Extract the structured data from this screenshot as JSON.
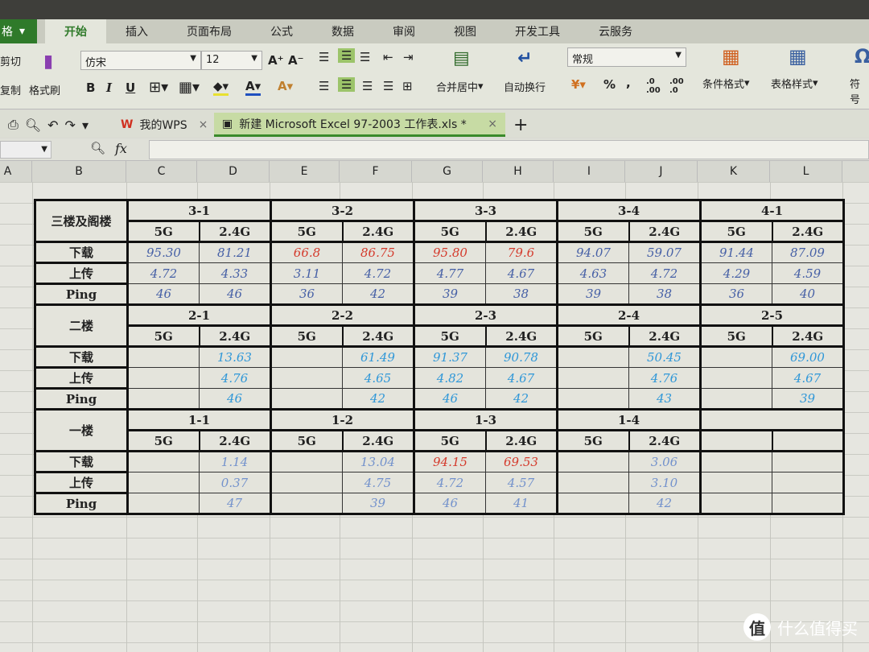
{
  "app": {
    "menu_label": "格"
  },
  "ribbon_tabs": [
    "开始",
    "插入",
    "页面布局",
    "公式",
    "数据",
    "审阅",
    "视图",
    "开发工具",
    "云服务"
  ],
  "active_tab": "开始",
  "ribbon": {
    "cut": "剪切",
    "copy": "复制",
    "format_painter": "格式刷",
    "font_name": "仿宋",
    "font_size": "12",
    "merge_center": "合并居中",
    "wrap_text": "自动换行",
    "number_format": "常规",
    "percent": "%",
    "comma": ",",
    "conditional_format": "条件格式",
    "table_style": "表格样式",
    "symbol": "符号",
    "bold": "B",
    "italic": "I",
    "underline": "U"
  },
  "doc_tabs": [
    {
      "label": "我的WPS",
      "active": false
    },
    {
      "label": "新建 Microsoft Excel 97-2003 工作表.xls *",
      "active": true
    }
  ],
  "formula_bar": {
    "fx": "fx",
    "value": ""
  },
  "columns": [
    "A",
    "B",
    "C",
    "D",
    "E",
    "F",
    "G",
    "H",
    "I",
    "J",
    "K",
    "L"
  ],
  "row_labels": {
    "down": "下载",
    "up": "上传",
    "ping": "Ping"
  },
  "colors": {
    "red": "#d43a2c",
    "navy": "#4660a6",
    "sky": "#2f97d8",
    "steel": "#7392cc"
  },
  "floors": [
    {
      "label": "三楼及阁楼",
      "units": [
        {
          "name": "3-1",
          "cols": [
            {
              "band": "5G",
              "down": "95.30",
              "up": "4.72",
              "ping": "46",
              "c": "navy"
            },
            {
              "band": "2.4G",
              "down": "81.21",
              "up": "4.33",
              "ping": "46",
              "c": "navy"
            }
          ]
        },
        {
          "name": "3-2",
          "cols": [
            {
              "band": "5G",
              "down": "66.8",
              "up": "3.11",
              "ping": "36",
              "c": "navy",
              "dc": "red"
            },
            {
              "band": "2.4G",
              "down": "86.75",
              "up": "4.72",
              "ping": "42",
              "c": "navy",
              "dc": "red"
            }
          ]
        },
        {
          "name": "3-3",
          "cols": [
            {
              "band": "5G",
              "down": "95.80",
              "up": "4.77",
              "ping": "39",
              "c": "navy",
              "dc": "red"
            },
            {
              "band": "2.4G",
              "down": "79.6",
              "up": "4.67",
              "ping": "38",
              "c": "navy",
              "dc": "red"
            }
          ]
        },
        {
          "name": "3-4",
          "cols": [
            {
              "band": "5G",
              "down": "94.07",
              "up": "4.63",
              "ping": "39",
              "c": "navy"
            },
            {
              "band": "2.4G",
              "down": "59.07",
              "up": "4.72",
              "ping": "38",
              "c": "navy"
            }
          ]
        },
        {
          "name": "4-1",
          "cols": [
            {
              "band": "5G",
              "down": "91.44",
              "up": "4.29",
              "ping": "36",
              "c": "navy"
            },
            {
              "band": "2.4G",
              "down": "87.09",
              "up": "4.59",
              "ping": "40",
              "c": "navy"
            }
          ]
        }
      ]
    },
    {
      "label": "二楼",
      "units": [
        {
          "name": "2-1",
          "cols": [
            {
              "band": "5G",
              "down": "",
              "up": "",
              "ping": "",
              "c": "sky"
            },
            {
              "band": "2.4G",
              "down": "13.63",
              "up": "4.76",
              "ping": "46",
              "c": "sky"
            }
          ]
        },
        {
          "name": "2-2",
          "cols": [
            {
              "band": "5G",
              "down": "",
              "up": "",
              "ping": "",
              "c": "sky"
            },
            {
              "band": "2.4G",
              "down": "61.49",
              "up": "4.65",
              "ping": "42",
              "c": "sky"
            }
          ]
        },
        {
          "name": "2-3",
          "cols": [
            {
              "band": "5G",
              "down": "91.37",
              "up": "4.82",
              "ping": "46",
              "c": "sky"
            },
            {
              "band": "2.4G",
              "down": "90.78",
              "up": "4.67",
              "ping": "42",
              "c": "sky"
            }
          ]
        },
        {
          "name": "2-4",
          "cols": [
            {
              "band": "5G",
              "down": "",
              "up": "",
              "ping": "",
              "c": "sky"
            },
            {
              "band": "2.4G",
              "down": "50.45",
              "up": "4.76",
              "ping": "43",
              "c": "sky"
            }
          ]
        },
        {
          "name": "2-5",
          "cols": [
            {
              "band": "5G",
              "down": "",
              "up": "",
              "ping": "",
              "c": "sky"
            },
            {
              "band": "2.4G",
              "down": "69.00",
              "up": "4.67",
              "ping": "39",
              "c": "sky"
            }
          ]
        }
      ]
    },
    {
      "label": "一楼",
      "units": [
        {
          "name": "1-1",
          "cols": [
            {
              "band": "5G",
              "down": "",
              "up": "",
              "ping": "",
              "c": "steel"
            },
            {
              "band": "2.4G",
              "down": "1.14",
              "up": "0.37",
              "ping": "47",
              "c": "steel"
            }
          ]
        },
        {
          "name": "1-2",
          "cols": [
            {
              "band": "5G",
              "down": "",
              "up": "",
              "ping": "",
              "c": "steel"
            },
            {
              "band": "2.4G",
              "down": "13.04",
              "up": "4.75",
              "ping": "39",
              "c": "steel"
            }
          ]
        },
        {
          "name": "1-3",
          "cols": [
            {
              "band": "5G",
              "down": "94.15",
              "up": "4.72",
              "ping": "46",
              "c": "steel",
              "dc": "red"
            },
            {
              "band": "2.4G",
              "down": "69.53",
              "up": "4.57",
              "ping": "41",
              "c": "steel",
              "dc": "red"
            }
          ]
        },
        {
          "name": "1-4",
          "cols": [
            {
              "band": "5G",
              "down": "",
              "up": "",
              "ping": "",
              "c": "steel"
            },
            {
              "band": "2.4G",
              "down": "3.06",
              "up": "3.10",
              "ping": "42",
              "c": "steel"
            }
          ]
        },
        {
          "name": "",
          "cols": [
            {
              "band": "",
              "down": "",
              "up": "",
              "ping": "",
              "c": "steel"
            },
            {
              "band": "",
              "down": "",
              "up": "",
              "ping": "",
              "c": "steel"
            }
          ]
        }
      ]
    }
  ],
  "watermark": "什么值得买"
}
